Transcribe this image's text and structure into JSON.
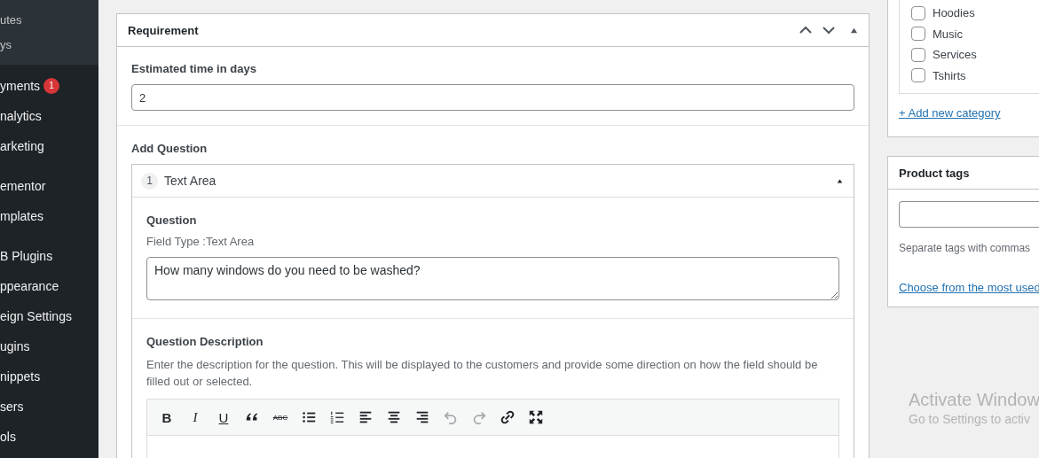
{
  "sidebar": {
    "submenu": [
      "utes",
      "ys"
    ],
    "groups": [
      {
        "items": [
          {
            "label": "yments",
            "badge": "1"
          },
          {
            "label": "nalytics"
          },
          {
            "label": "arketing"
          }
        ]
      },
      {
        "items": [
          {
            "label": "ementor"
          },
          {
            "label": "mplates"
          }
        ]
      },
      {
        "items": [
          {
            "label": "B Plugins"
          },
          {
            "label": "ppearance"
          },
          {
            "label": "eign Settings"
          },
          {
            "label": "ugins"
          },
          {
            "label": "nippets"
          },
          {
            "label": "sers"
          },
          {
            "label": "ols"
          }
        ]
      }
    ]
  },
  "requirement": {
    "title": "Requirement",
    "expanded": true,
    "estimated_label": "Estimated time in days",
    "estimated_value": "2",
    "add_question_label": "Add Question",
    "question": {
      "number": "1",
      "title": "Text Area",
      "expanded": true,
      "question_label": "Question",
      "field_type": "Field Type :Text Area",
      "question_value": "How many windows do you need to be washed?",
      "description_label": "Question Description",
      "description_help": "Enter the description for the question. This will be displayed to the customers and provide some direction on how the field should be filled out or selected.",
      "toolbar": [
        {
          "kind": "bold",
          "label": "B",
          "disabled": false
        },
        {
          "kind": "italic",
          "label": "I",
          "disabled": false
        },
        {
          "kind": "underline",
          "label": "U",
          "disabled": false
        },
        {
          "kind": "quote",
          "disabled": false
        },
        {
          "kind": "strike",
          "label": "ABC",
          "disabled": false
        },
        {
          "kind": "bullets",
          "disabled": false
        },
        {
          "kind": "numbers",
          "disabled": false
        },
        {
          "kind": "align-left",
          "disabled": false
        },
        {
          "kind": "align-center",
          "disabled": false
        },
        {
          "kind": "align-right",
          "disabled": false
        },
        {
          "kind": "undo",
          "disabled": true
        },
        {
          "kind": "redo",
          "disabled": true
        },
        {
          "kind": "link",
          "disabled": false
        },
        {
          "kind": "fullscreen",
          "disabled": false
        }
      ]
    }
  },
  "categories": {
    "items": [
      {
        "label": "Hoodies",
        "checked": false
      },
      {
        "label": "Music",
        "checked": false
      },
      {
        "label": "Services",
        "checked": false
      },
      {
        "label": "Tshirts",
        "checked": false
      }
    ],
    "add_link": "+ Add new category"
  },
  "product_tags": {
    "title": "Product tags",
    "help": "Separate tags with commas",
    "link": "Choose from the most used"
  },
  "activation_notice": {
    "title": "Activate Window",
    "subtitle": "Go to Settings to activ"
  }
}
